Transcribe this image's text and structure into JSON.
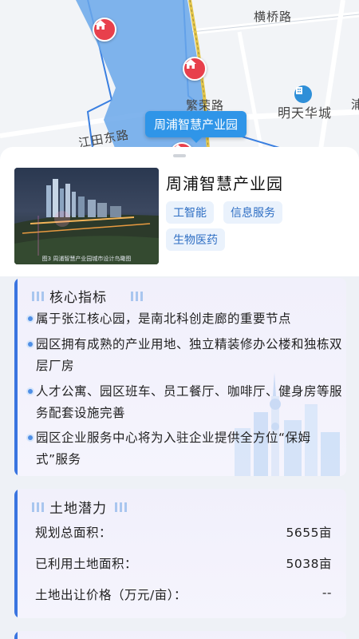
{
  "map": {
    "roads": [
      "横桥路",
      "繁荣路",
      "江田东路"
    ],
    "poi": "明天华城",
    "edge_label": "浦",
    "selected_park": "周浦智慧产业园",
    "colors": {
      "water": "#6aa7ea",
      "road_yellow": "#e6c84a",
      "pin": "#e8404c"
    }
  },
  "park": {
    "name": "周浦智慧产业园",
    "photo_caption": "图3 周浦智慧产业园城市设计鸟瞰图",
    "tags": [
      "工智能",
      "信息服务",
      "生物医药"
    ]
  },
  "core": {
    "title": "核心指标",
    "items": [
      "属于张江核心园，是南北科创走廊的重要节点",
      "园区拥有成熟的产业用地、独立精装修办公楼和独栋双层厂房",
      "人才公寓、园区班车、员工餐厅、咖啡厅、健身房等服务配套设施完善",
      "园区企业服务中心将为入驻企业提供全方位“保姆式”服务"
    ]
  },
  "land": {
    "title": "土地潜力",
    "rows": [
      {
        "label": "规划总面积：",
        "value": "5655亩"
      },
      {
        "label": "已利用土地面积：",
        "value": "5038亩"
      },
      {
        "label": "土地出让价格（万元/亩）：",
        "value": "--"
      }
    ]
  }
}
